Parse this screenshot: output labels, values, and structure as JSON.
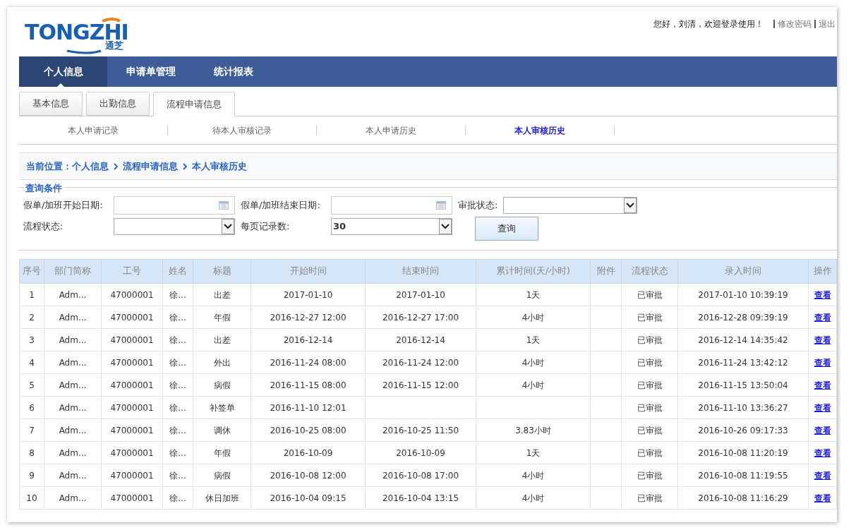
{
  "header": {
    "logo": {
      "text": "TONGZHI",
      "subtext": "通芝"
    },
    "greeting": "您好，刘清，欢迎登录使用！",
    "links": [
      "修改密码",
      "退出"
    ]
  },
  "nav": [
    {
      "label": "个人信息",
      "selected": true
    },
    {
      "label": "申请单管理",
      "selected": false
    },
    {
      "label": "统计报表",
      "selected": false
    }
  ],
  "tabs": [
    {
      "label": "基本信息",
      "selected": false
    },
    {
      "label": "出勤信息",
      "selected": false
    },
    {
      "label": "流程申请信息",
      "selected": true
    }
  ],
  "sub_links": [
    {
      "label": "本人申请记录",
      "selected": false
    },
    {
      "label": "待本人审核记录",
      "selected": false
    },
    {
      "label": "本人申请历史",
      "selected": false
    },
    {
      "label": "本人审核历史",
      "selected": true
    }
  ],
  "breadcrumb": {
    "prefix": "当前位置：",
    "items": [
      "个人信息",
      "流程申请信息",
      "本人审核历史"
    ]
  },
  "filter": {
    "legend": "查询条件",
    "fields": [
      {
        "kind": "date",
        "label": "假单/加班开始日期:"
      },
      {
        "kind": "date",
        "label": "假单/加班结束日期:"
      },
      {
        "kind": "select",
        "label": "审批状态:"
      },
      {
        "kind": "select",
        "label": "流程状态:"
      },
      {
        "kind": "select",
        "label": "每页记录数:",
        "value": "30"
      }
    ],
    "button": "查询"
  },
  "table": {
    "columns": [
      {
        "label": "序号"
      },
      {
        "label": "部门简称"
      },
      {
        "label": "工号"
      },
      {
        "label": "姓名"
      },
      {
        "label": "标题"
      },
      {
        "label": "开始时间"
      },
      {
        "label": "结束时间"
      },
      {
        "label": "累计时间(天/小时)"
      },
      {
        "label": "附件"
      },
      {
        "label": "流程状态"
      },
      {
        "label": "录入时间"
      },
      {
        "label": "操作",
        "kind": "link"
      }
    ],
    "rows": [
      [
        "1",
        "Adm...",
        "47000001",
        "徐...",
        "出差",
        "2017-01-10",
        "2017-01-10",
        "1天",
        "",
        "已审批",
        "2017-01-10 10:39:19",
        "查看"
      ],
      [
        "2",
        "Adm...",
        "47000001",
        "徐...",
        "年假",
        "2016-12-27 12:00",
        "2016-12-27 17:00",
        "4小时",
        "",
        "已审批",
        "2016-12-28 09:39:19",
        "查看"
      ],
      [
        "3",
        "Adm...",
        "47000001",
        "徐...",
        "出差",
        "2016-12-14",
        "2016-12-14",
        "1天",
        "",
        "已审批",
        "2016-12-14 14:35:42",
        "查看"
      ],
      [
        "4",
        "Adm...",
        "47000001",
        "徐...",
        "外出",
        "2016-11-24 08:00",
        "2016-11-24 12:00",
        "4小时",
        "",
        "已审批",
        "2016-11-24 13:42:12",
        "查看"
      ],
      [
        "5",
        "Adm...",
        "47000001",
        "徐...",
        "病假",
        "2016-11-15 08:00",
        "2016-11-15 12:00",
        "4小时",
        "",
        "已审批",
        "2016-11-15 13:50:04",
        "查看"
      ],
      [
        "6",
        "Adm...",
        "47000001",
        "徐...",
        "补签单",
        "2016-11-10 12:01",
        "",
        "",
        "",
        "已审批",
        "2016-11-10 13:36:27",
        "查看"
      ],
      [
        "7",
        "Adm...",
        "47000001",
        "徐...",
        "调休",
        "2016-10-25 08:00",
        "2016-10-25 11:50",
        "3.83小时",
        "",
        "已审批",
        "2016-10-26 09:17:33",
        "查看"
      ],
      [
        "8",
        "Adm...",
        "47000001",
        "徐...",
        "年假",
        "2016-10-09",
        "2016-10-09",
        "1天",
        "",
        "已审批",
        "2016-10-08 11:20:19",
        "查看"
      ],
      [
        "9",
        "Adm...",
        "47000001",
        "徐...",
        "病假",
        "2016-10-08 12:00",
        "2016-10-08 17:00",
        "4小时",
        "",
        "已审批",
        "2016-10-08 11:19:55",
        "查看"
      ],
      [
        "10",
        "Adm...",
        "47000001",
        "徐...",
        "休日加班",
        "2016-10-04 09:15",
        "2016-10-04 13:15",
        "4小时",
        "",
        "已审批",
        "2016-10-08 11:16:29",
        "查看"
      ]
    ]
  }
}
